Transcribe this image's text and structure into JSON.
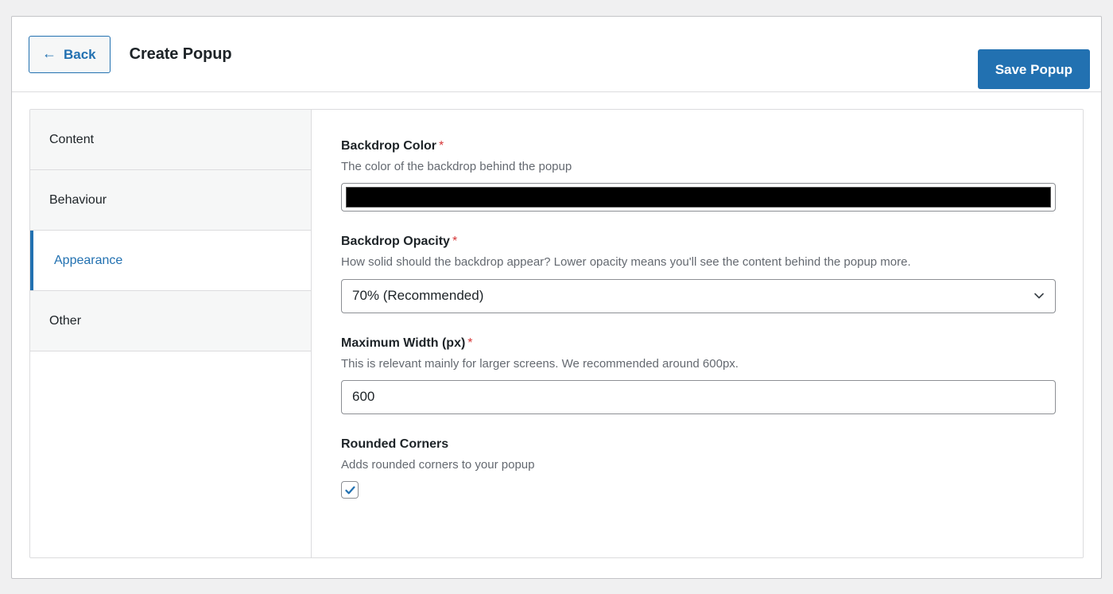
{
  "header": {
    "back_label": "Back",
    "back_icon": "arrow-left-icon",
    "title": "Create Popup",
    "save_label": "Save Popup"
  },
  "colors": {
    "accent": "#2271b1",
    "required": "#d63638",
    "page_background": "#f0f0f1",
    "panel_border": "#dcdcde",
    "sidebar_item_background": "#f6f7f7",
    "label_text": "#1d2327",
    "help_text": "#646970"
  },
  "sidebar": {
    "items": [
      {
        "label": "Content",
        "active": false
      },
      {
        "label": "Behaviour",
        "active": false
      },
      {
        "label": "Appearance",
        "active": true
      },
      {
        "label": "Other",
        "active": false
      }
    ]
  },
  "content": {
    "fields": [
      {
        "label": "Backdrop Color",
        "required": true,
        "required_mark": "*",
        "help": "The color of the backdrop behind the popup",
        "type": "color",
        "value": "#000000"
      },
      {
        "label": "Backdrop Opacity",
        "required": true,
        "required_mark": "*",
        "help": "How solid should the backdrop appear? Lower opacity means you'll see the content behind the popup more.",
        "type": "select",
        "value": "70% (Recommended)",
        "icon": "chevron-down-icon"
      },
      {
        "label": "Maximum Width (px)",
        "required": true,
        "required_mark": "*",
        "help": "This is relevant mainly for larger screens. We recommended around 600px.",
        "type": "number",
        "value": "600",
        "placeholder": ""
      },
      {
        "label": "Rounded Corners",
        "required": false,
        "required_mark": "",
        "help": "Adds rounded corners to your popup",
        "type": "checkbox",
        "checked": true
      }
    ]
  }
}
